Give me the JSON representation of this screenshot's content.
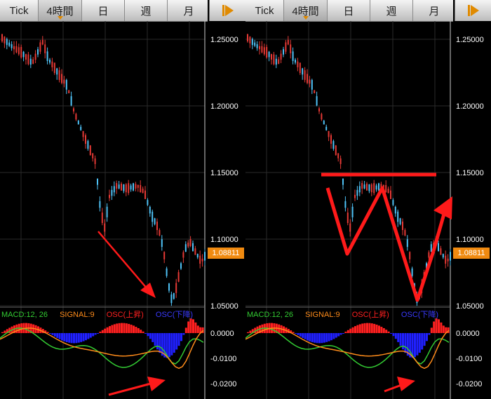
{
  "toolbar": {
    "tabs": [
      {
        "label": "Tick"
      },
      {
        "label": "4時間"
      },
      {
        "label": "日"
      },
      {
        "label": "週"
      },
      {
        "label": "月"
      }
    ]
  },
  "colors": {
    "candle_up": "#4fc3f7",
    "candle_down": "#e53935",
    "macd": "#33cc33",
    "signal": "#ff8c1a",
    "osc_up": "#ff2020",
    "osc_down": "#2020ff",
    "accent": "#f08a10",
    "annotation": "#ff1a1a"
  },
  "price_axis": {
    "labels": [
      "1.25000",
      "1.20000",
      "1.15000",
      "1.10000",
      "1.05000"
    ],
    "current": "1.08811"
  },
  "osc_axis": {
    "labels": [
      "0.0000",
      "-0.0100",
      "-0.0200"
    ]
  },
  "legend": {
    "macd": "MACD:12, 26",
    "signal": "SIGNAL:9",
    "osc_up": "OSC(上昇)",
    "osc_down": "OSC(下降)"
  }
}
